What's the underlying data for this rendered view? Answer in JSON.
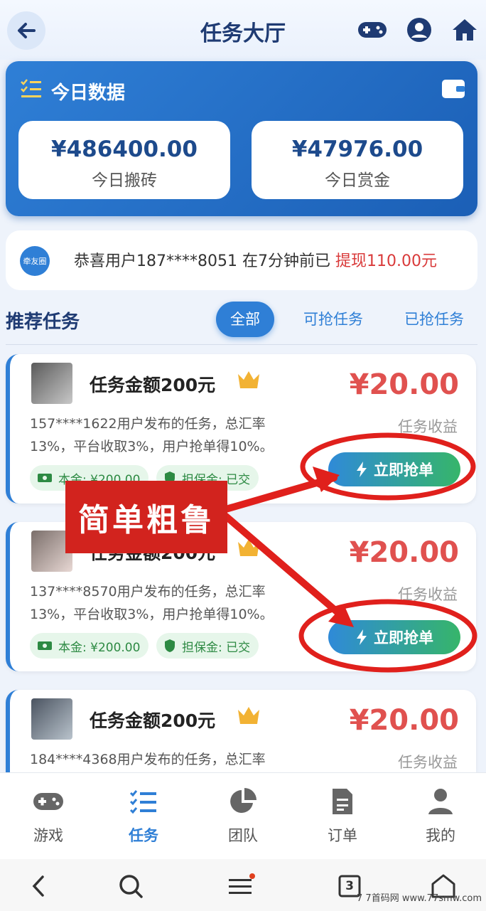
{
  "header": {
    "title": "任务大厅"
  },
  "stats": {
    "title": "今日数据",
    "items": [
      {
        "value": "¥486400.00",
        "label": "今日搬砖"
      },
      {
        "value": "¥47976.00",
        "label": "今日赏金"
      }
    ]
  },
  "notice": {
    "logo_text": "牵友圈",
    "text": "恭喜用户187****8051 在7分钟前已 ",
    "amount": "提现110.00元"
  },
  "section": {
    "title": "推荐任务",
    "tabs": [
      "全部",
      "可抢任务",
      "已抢任务"
    ]
  },
  "tasks": [
    {
      "title": "任务金额200元",
      "price": "¥20.00",
      "income_label": "任务收益",
      "desc": "157****1622用户发布的任务，总汇率13%，平台收取3%，用户抢单得10%。",
      "principal": "本金: ¥200.00",
      "deposit": "担保金: 已交",
      "button": "立即抢单"
    },
    {
      "title": "任务金额200元",
      "price": "¥20.00",
      "income_label": "任务收益",
      "desc": "137****8570用户发布的任务，总汇率13%，平台收取3%，用户抢单得10%。",
      "principal": "本金: ¥200.00",
      "deposit": "担保金: 已交",
      "button": "立即抢单"
    },
    {
      "title": "任务金额200元",
      "price": "¥20.00",
      "income_label": "任务收益",
      "desc": "184****4368用户发布的任务，总汇率",
      "principal": "",
      "deposit": "",
      "button": ""
    }
  ],
  "annotation": {
    "text": "简单粗鲁"
  },
  "nav": [
    {
      "label": "游戏",
      "icon": "gamepad-icon"
    },
    {
      "label": "任务",
      "icon": "task-list-icon"
    },
    {
      "label": "团队",
      "icon": "pie-chart-icon"
    },
    {
      "label": "订单",
      "icon": "document-icon"
    },
    {
      "label": "我的",
      "icon": "user-icon"
    }
  ],
  "system": {
    "tab_count": "3"
  },
  "watermark": "7 7首码网 www.77smw.com",
  "colors": {
    "primary": "#2f7fd6",
    "price": "#e0514f",
    "annotation": "#d2231e"
  }
}
